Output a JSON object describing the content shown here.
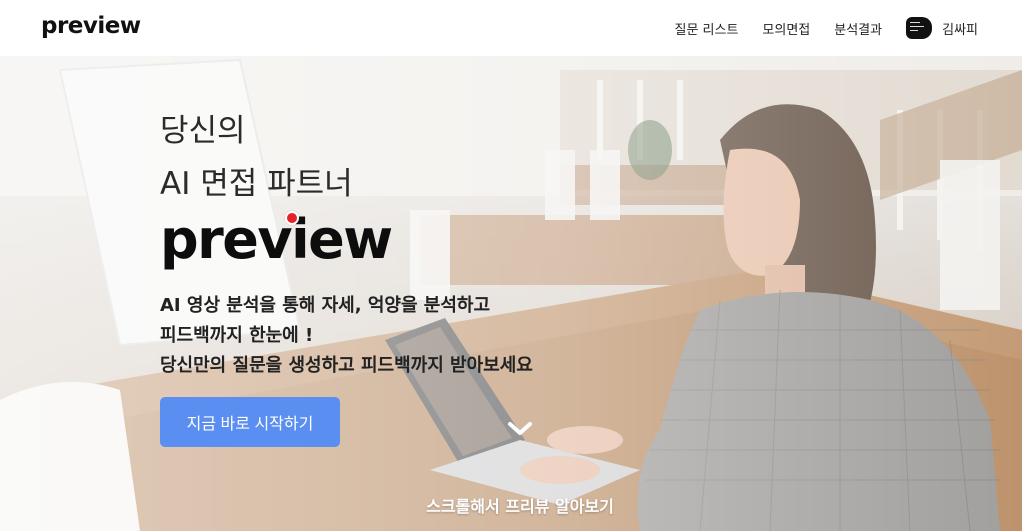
{
  "header": {
    "logo": "preview",
    "nav": [
      "질문 리스트",
      "모의면접",
      "분석결과"
    ],
    "user_name": "김싸피"
  },
  "hero": {
    "tagline": [
      "당신의",
      "AI 면접 파트너"
    ],
    "brand": "preview",
    "description": [
      "AI 영상 분석을 통해 자세, 억양을 분석하고",
      "피드백까지 한눈에 !",
      "당신만의 질문을 생성하고 피드백까지 받아보세요"
    ],
    "cta_label": "지금 바로 시작하기",
    "scroll_label": "스크롤해서 프리뷰 알아보기"
  },
  "colors": {
    "accent": "#5a8ef0",
    "brand_dot": "#e8202a",
    "text": "#222222"
  },
  "icons": [
    "chevron-down-icon",
    "avatar-icon"
  ]
}
